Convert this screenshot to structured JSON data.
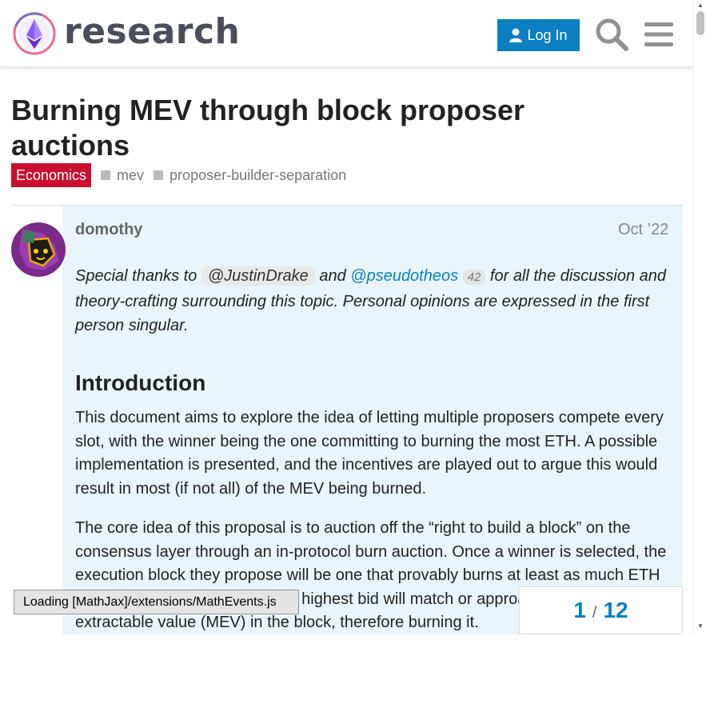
{
  "header": {
    "site_name": "research",
    "login_label": "Log In",
    "search_icon": "search-icon",
    "menu_icon": "hamburger-menu-icon"
  },
  "topic": {
    "title": "Burning MEV through block proposer auctions",
    "category": "Economics",
    "category_color": "#c8102e",
    "tags": [
      "mev",
      "proposer-builder-separation"
    ]
  },
  "post": {
    "username": "domothy",
    "date": "Oct ’22",
    "intro_prefix": "Special thanks to ",
    "mention1": "@JustinDrake",
    "intro_and": " and ",
    "mention2": "@pseudotheos",
    "mention2_count": "42",
    "intro_suffix": " for all the discussion and theory-crafting surrounding this topic. Personal opinions are expressed in the first person singular.",
    "heading": "Introduction",
    "para1": "This document aims to explore the idea of letting multiple proposers compete every slot, with the winner being the one committing to burning the most ETH. A possible implementation is presented, and the incentives are played out to argue this would result in most (if not all) of the MEV being burned.",
    "para2": "The core idea of this proposal is to auction off the “right to build a block” on the consensus layer through an in-protocol burn auction. Once a winner is selected, the execution block they propose will be one that provably burns at least as much ETH as they bid. The idea is that the highest bid will match or approach the maximal extractable value (MEV) in the block, therefore burning it."
  },
  "mathjax_status": "Loading [MathJax]/extensions/MathEvents.js",
  "timeline": {
    "current": "1",
    "separator": "/",
    "total": "12"
  },
  "colors": {
    "accent": "#0a7fc2",
    "post_bg": "#e8f6fc"
  }
}
